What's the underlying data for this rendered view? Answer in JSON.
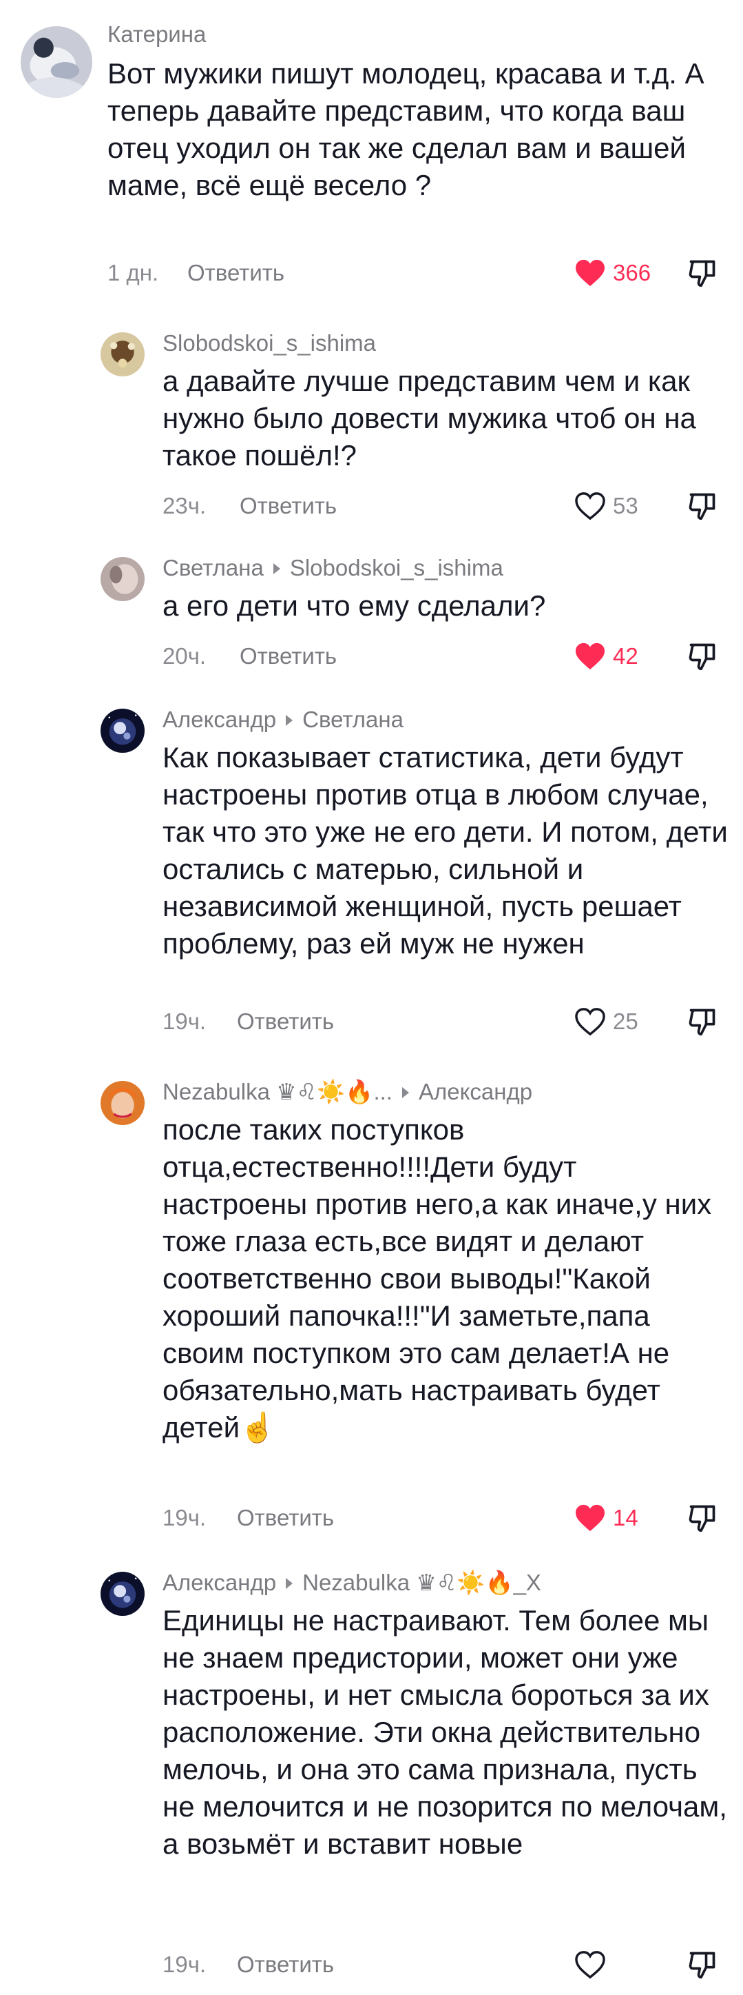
{
  "comments": [
    {
      "username": "Катерина",
      "text": "Вот мужики пишут молодец, красава и т.д. А теперь давайте представим, что когда ваш отец уходил он так же сделал вам и вашей маме, всё ещё весело ?",
      "time": "1 дн.",
      "reply_label": "Ответить",
      "likes": "366",
      "liked": true
    },
    {
      "username": "Slobodskoi_s_ishima",
      "text": "а давайте лучше представим чем и как нужно было довести мужика чтоб он на такое пошёл!?",
      "time": "23ч.",
      "reply_label": "Ответить",
      "likes": "53",
      "liked": false
    },
    {
      "username": "Светлана",
      "reply_to": "Slobodskoi_s_ishima",
      "text": "а его дети что ему сделали?",
      "time": "20ч.",
      "reply_label": "Ответить",
      "likes": "42",
      "liked": true
    },
    {
      "username": "Александр",
      "reply_to": "Светлана",
      "text": "Как показывает статистика, дети будут настроены против отца в любом случае, так что это уже не его дети. И потом, дети остались с матерью, сильной и независимой женщиной, пусть решает проблему, раз ей муж не нужен",
      "time": "19ч.",
      "reply_label": "Ответить",
      "likes": "25",
      "liked": false
    },
    {
      "username": "Nezabulka ♛♌☀️🔥...",
      "reply_to": "Александр",
      "text": "после таких поступков отца,естественно!!!!Дети будут настроены против него,а как иначе,у них тоже глаза есть,все видят и делают соответственно свои выводы!\"Какой хороший папочка!!!\"И заметьте,папа своим поступком это сам делает!А не обязательно,мать настраивать будет детей☝️",
      "time": "19ч.",
      "reply_label": "Ответить",
      "likes": "14",
      "liked": true
    },
    {
      "username": "Александр",
      "reply_to": "Nezabulka ♛♌☀️🔥_X",
      "text": "Единицы не настраивают. Тем более мы не знаем предистории, может они уже настроены, и нет смысла бороться за их расположение. Эти окна действительно мелочь, и она это сама признала, пусть не мелочится и не позорится по мелочам, а возьмёт и вставит новые",
      "time": "19ч.",
      "reply_label": "Ответить",
      "likes": "",
      "liked": false
    }
  ],
  "colors": {
    "like_active": "#fe2c55",
    "text": "#161823",
    "muted": "#8a8b91"
  }
}
